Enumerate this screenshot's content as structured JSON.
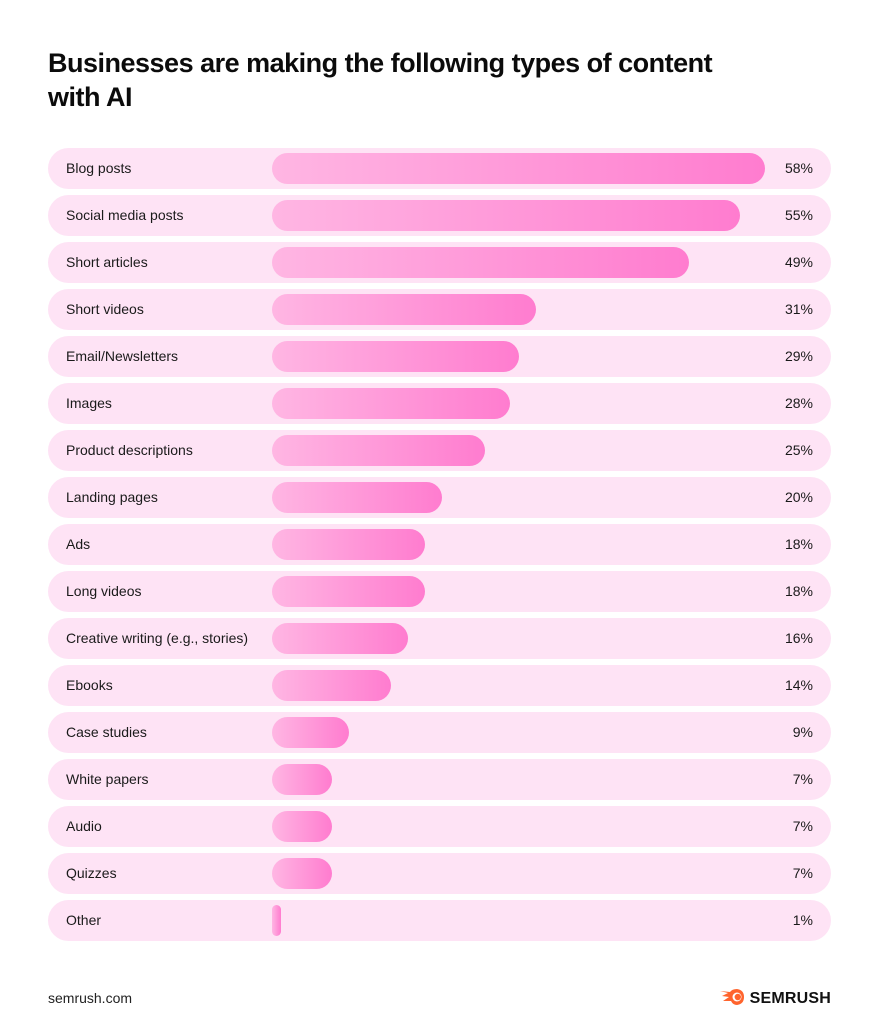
{
  "title": "Businesses are making the following types of content with AI",
  "footer": {
    "source": "semrush.com",
    "brand": "SEMRUSH",
    "brand_icon": "semrush-fire-icon",
    "brand_color": "#ff642d"
  },
  "colors": {
    "track": "#fee3f5",
    "bar_start": "#ffb6e3",
    "bar_end": "#ff7ccf"
  },
  "chart_data": {
    "type": "bar",
    "orientation": "horizontal",
    "title": "Businesses are making the following types of content with AI",
    "xlabel": "",
    "ylabel": "",
    "xlim": [
      0,
      100
    ],
    "grid": false,
    "unit": "%",
    "categories": [
      "Blog posts",
      "Social media posts",
      "Short articles",
      "Short videos",
      "Email/Newsletters",
      "Images",
      "Product descriptions",
      "Landing pages",
      "Ads",
      "Long videos",
      "Creative writing (e.g., stories)",
      "Ebooks",
      "Case studies",
      "White papers",
      "Audio",
      "Quizzes",
      "Other"
    ],
    "values": [
      58,
      55,
      49,
      31,
      29,
      28,
      25,
      20,
      18,
      18,
      16,
      14,
      9,
      7,
      7,
      7,
      1
    ],
    "labels": [
      "58%",
      "55%",
      "49%",
      "31%",
      "29%",
      "28%",
      "25%",
      "20%",
      "18%",
      "18%",
      "16%",
      "14%",
      "9%",
      "7%",
      "7%",
      "7%",
      "1%"
    ]
  }
}
